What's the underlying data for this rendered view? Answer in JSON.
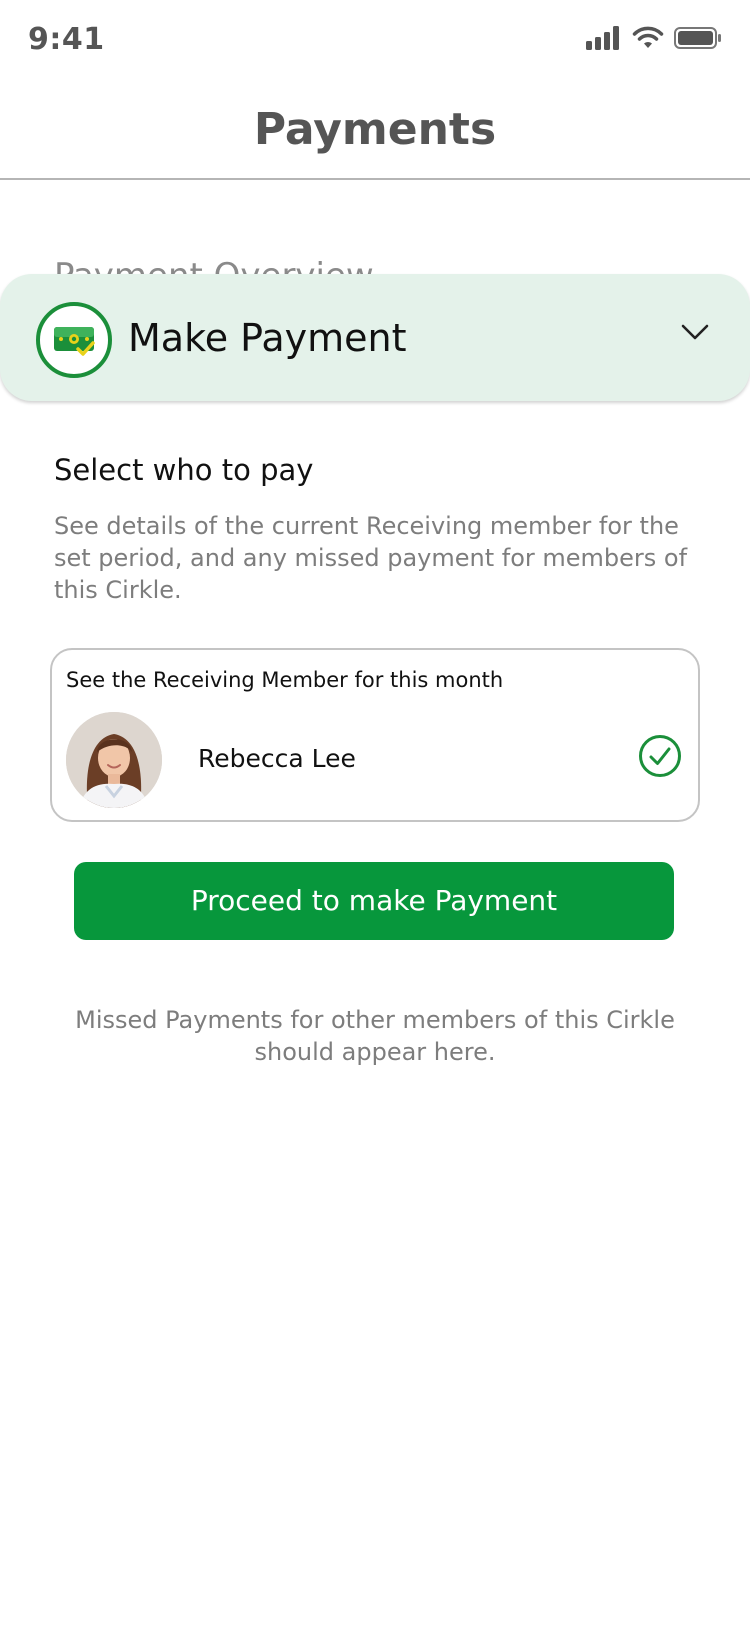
{
  "status_bar": {
    "time": "9:41",
    "icons": [
      "signal-icon",
      "wifi-icon",
      "battery-icon"
    ]
  },
  "header": {
    "title": "Payments"
  },
  "overview_peek": "Payment Overview",
  "accordion": {
    "title": "Make Payment",
    "icon": "payment-check-icon",
    "chevron": "chevron-down-icon"
  },
  "select_section": {
    "title": "Select who to pay",
    "description": "See details of the current Receiving member for the set period, and any missed payment for members of this Cirkle."
  },
  "receiving_card": {
    "label": "See the Receiving Member for this month",
    "member_name": "Rebecca Lee",
    "selected": true
  },
  "proceed_button": {
    "label": "Proceed to make Payment"
  },
  "missed_note": "Missed Payments for other members of this Cirkle should appear here.",
  "colors": {
    "primary": "#07973c",
    "accordion_bg": "#e4f2ea",
    "muted_text": "#7d7d7d"
  }
}
